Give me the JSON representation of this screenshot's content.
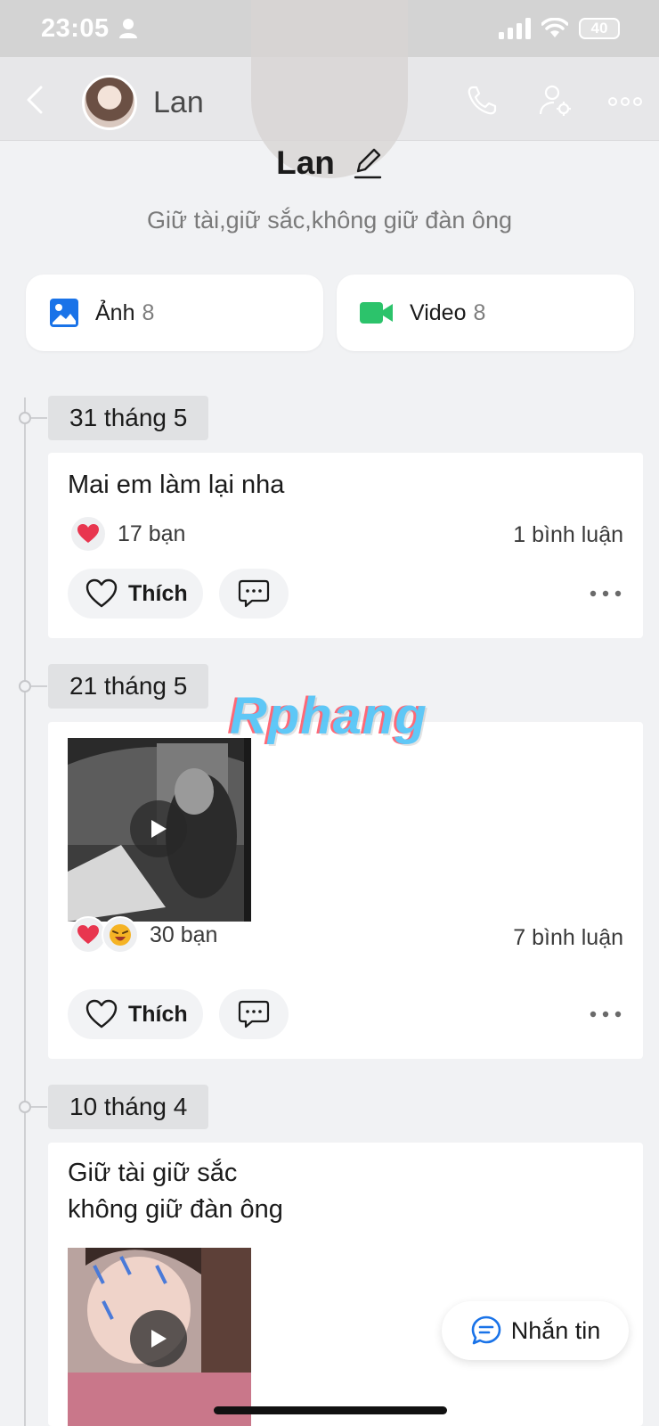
{
  "status_bar": {
    "time": "23:05",
    "battery": "40"
  },
  "header": {
    "name": "Lan"
  },
  "profile": {
    "name": "Lan",
    "status": "Giữ tài,giữ sắc,không giữ đàn ông"
  },
  "media": [
    {
      "label": "Ảnh",
      "count": "8",
      "icon": "image-icon",
      "color": "#1a73e8"
    },
    {
      "label": "Video",
      "count": "8",
      "icon": "video-camera-icon",
      "color": "#2cc36b"
    }
  ],
  "posts": [
    {
      "date": "31 tháng 5",
      "text": "Mai em làm lại nha",
      "reactions_count": "17 bạn",
      "comments": "1 bình luận",
      "like_label": "Thích"
    },
    {
      "date": "21 tháng 5",
      "reactions_count": "30 bạn",
      "comments": "7 bình luận",
      "like_label": "Thích"
    },
    {
      "date": "10 tháng 4",
      "text_line1": "Giữ tài giữ sắc",
      "text_line2": "không giữ đàn ông"
    }
  ],
  "watermark": "Rphang",
  "message_button": {
    "label": "Nhắn tin"
  },
  "colors": {
    "heart": "#e8364f",
    "accent": "#1a73e8",
    "video_green": "#2cc36b",
    "watermark_blue": "#4fc3f7",
    "watermark_red": "#ff5a6a"
  }
}
